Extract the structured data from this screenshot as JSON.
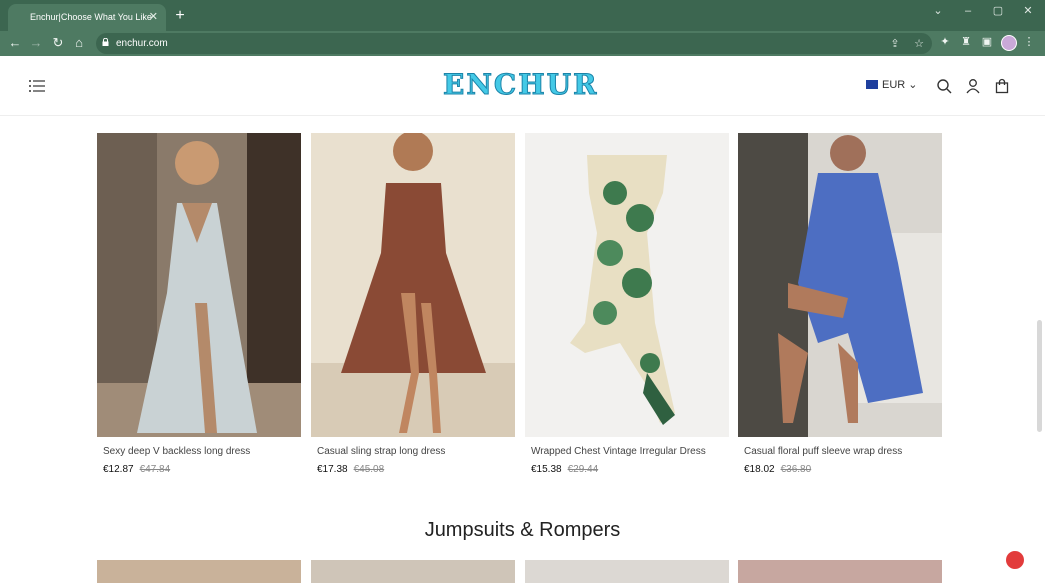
{
  "browser": {
    "tab_title": "Enchur|Choose What You Like",
    "url": "enchur.com",
    "icons": [
      "back-icon",
      "forward-icon",
      "reload-icon",
      "home-icon",
      "lock-icon",
      "share-icon",
      "star-icon",
      "puzzle-icon",
      "extension-icon",
      "sidebar-icon",
      "profile-avatar",
      "menu-dots-icon"
    ]
  },
  "header": {
    "logo_text": "ENCHUR",
    "currency": "EUR",
    "icons": [
      "hamburger-menu-icon",
      "search-icon",
      "account-icon",
      "cart-icon"
    ]
  },
  "products": [
    {
      "name": "Sexy deep V backless long dress",
      "price": "€12.87",
      "old_price": "€47.84"
    },
    {
      "name": "Casual sling strap long dress",
      "price": "€17.38",
      "old_price": "€45.08"
    },
    {
      "name": "Wrapped Chest Vintage Irregular Dress",
      "price": "€15.38",
      "old_price": "€29.44"
    },
    {
      "name": "Casual floral puff sleeve wrap dress",
      "price": "€18.02",
      "old_price": "€36.80"
    }
  ],
  "sections": {
    "next_title": "Jumpsuits & Rompers"
  },
  "colors": {
    "chrome": "#3c6650",
    "chrome_light": "#4e7a62",
    "logo": "#44c9e6",
    "chat": "#e23b3b"
  }
}
